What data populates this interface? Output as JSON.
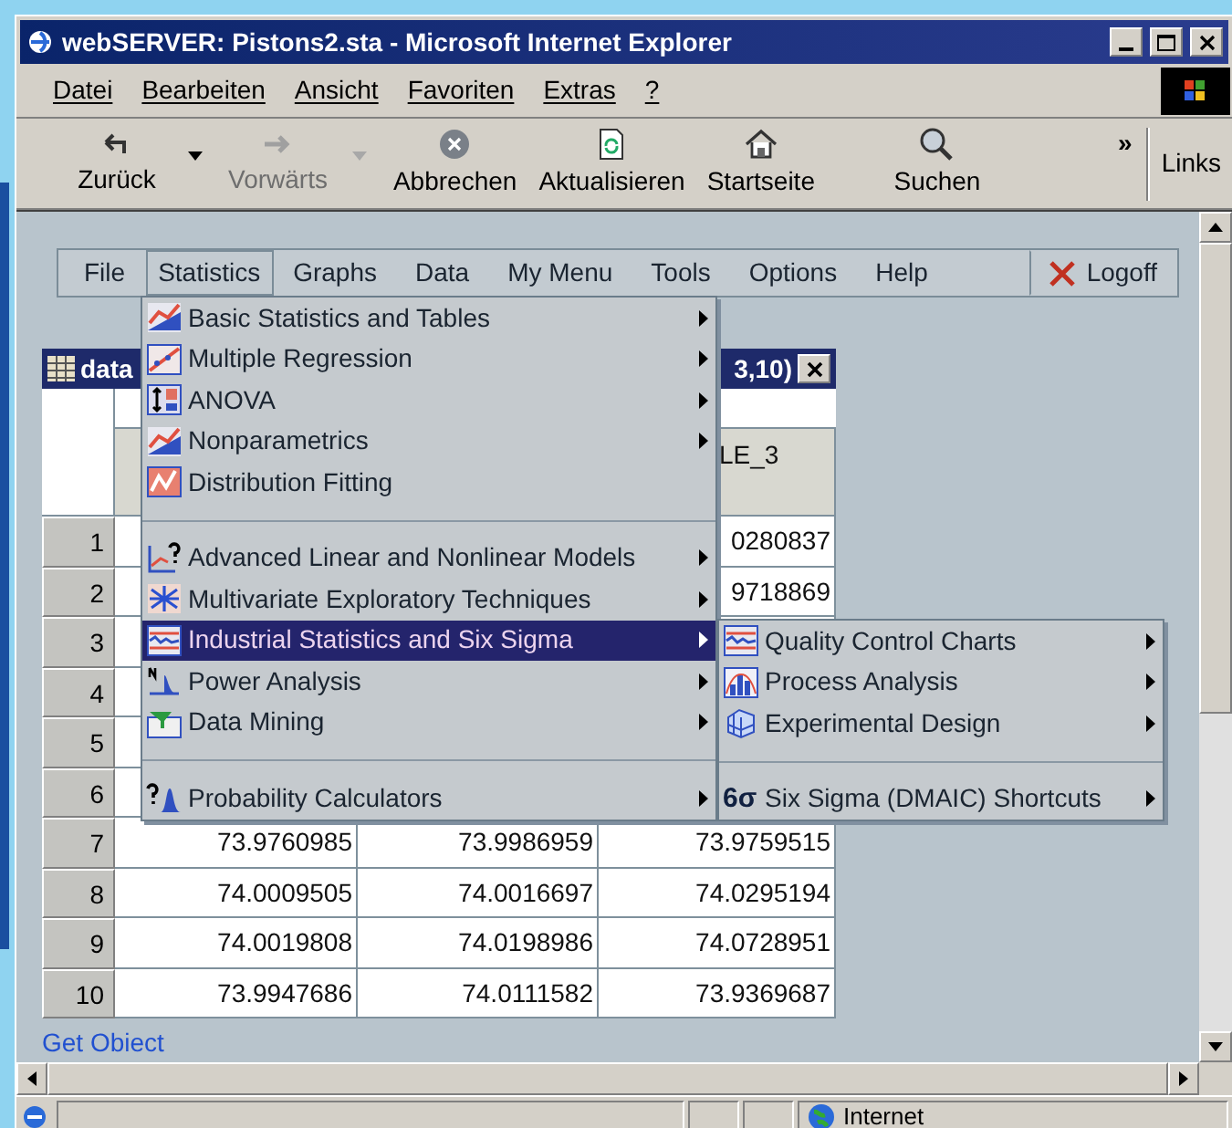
{
  "window": {
    "title": "webSERVER: Pistons2.sta - Microsoft Internet Explorer"
  },
  "menu_bar": [
    "Datei",
    "Bearbeiten",
    "Ansicht",
    "Favoriten",
    "Extras",
    "?"
  ],
  "toolbar": {
    "buttons": [
      {
        "label": "Zurück",
        "kind": "back",
        "disabled": false,
        "dropdown": true
      },
      {
        "label": "Vorwärts",
        "kind": "forward",
        "disabled": true,
        "dropdown": true
      },
      {
        "label": "Abbrechen",
        "kind": "stop",
        "disabled": false,
        "dropdown": false
      },
      {
        "label": "Aktualisieren",
        "kind": "refresh",
        "disabled": false,
        "dropdown": false
      },
      {
        "label": "Startseite",
        "kind": "home",
        "disabled": false,
        "dropdown": false
      },
      {
        "label": "Suchen",
        "kind": "search",
        "disabled": false,
        "dropdown": false
      }
    ],
    "overflow": "»",
    "links": "Links"
  },
  "app_menu": [
    {
      "label": "File",
      "selected": false,
      "kind": "plain"
    },
    {
      "label": "Statistics",
      "selected": true,
      "kind": "plain"
    },
    {
      "label": "Graphs",
      "selected": false,
      "kind": "plain"
    },
    {
      "label": "Data",
      "selected": false,
      "kind": "plain"
    },
    {
      "label": "My Menu",
      "selected": false,
      "kind": "plain"
    },
    {
      "label": "Tools",
      "selected": false,
      "kind": "plain"
    },
    {
      "label": "Options",
      "selected": false,
      "kind": "plain"
    },
    {
      "label": "Help",
      "selected": false,
      "kind": "plain"
    },
    {
      "label": "Logoff",
      "selected": false,
      "kind": "logoff"
    }
  ],
  "statistics_menu": [
    {
      "kind": "item",
      "label": "Basic Statistics and Tables",
      "submenu": true,
      "selected": false
    },
    {
      "kind": "item",
      "label": "Multiple Regression",
      "submenu": true,
      "selected": false
    },
    {
      "kind": "item",
      "label": "ANOVA",
      "submenu": true,
      "selected": false
    },
    {
      "kind": "item",
      "label": "Nonparametrics",
      "submenu": true,
      "selected": false
    },
    {
      "kind": "item",
      "label": "Distribution Fitting",
      "submenu": false,
      "selected": false
    },
    {
      "kind": "separator"
    },
    {
      "kind": "item",
      "label": "Advanced Linear and Nonlinear Models",
      "submenu": true,
      "selected": false
    },
    {
      "kind": "item",
      "label": "Multivariate Exploratory Techniques",
      "submenu": true,
      "selected": false
    },
    {
      "kind": "item",
      "label": "Industrial Statistics and Six Sigma",
      "submenu": true,
      "selected": true
    },
    {
      "kind": "item",
      "label": "Power Analysis",
      "submenu": true,
      "selected": false
    },
    {
      "kind": "item",
      "label": "Data Mining",
      "submenu": true,
      "selected": false
    },
    {
      "kind": "separator"
    },
    {
      "kind": "item",
      "label": "Probability Calculators",
      "submenu": true,
      "selected": false
    }
  ],
  "industrial_submenu": [
    {
      "kind": "item",
      "label": "Quality Control Charts",
      "submenu": true,
      "selected": false
    },
    {
      "kind": "item",
      "label": "Process Analysis",
      "submenu": true,
      "selected": false
    },
    {
      "kind": "item",
      "label": "Experimental Design",
      "submenu": true,
      "selected": false
    },
    {
      "kind": "separator"
    },
    {
      "kind": "item",
      "label": "Six Sigma (DMAIC) Shortcuts",
      "icon_text": "6σ",
      "submenu": true,
      "selected": false
    }
  ],
  "data_window": {
    "title_start": "data",
    "title_end": "3,10)",
    "column_3_header": "LE_3",
    "rows": [
      {
        "number": "1",
        "column_3": "0280837"
      },
      {
        "number": "2",
        "column_3": "9718869"
      },
      {
        "number": "3"
      },
      {
        "number": "4"
      },
      {
        "number": "5"
      },
      {
        "number": "6"
      },
      {
        "number": "7",
        "column_1": "73.9760985",
        "column_2": "73.9986959",
        "column_3": "73.9759515"
      },
      {
        "number": "8",
        "column_1": "74.0009505",
        "column_2": "74.0016697",
        "column_3": "74.0295194"
      },
      {
        "number": "9",
        "column_1": "74.0019808",
        "column_2": "74.0198986",
        "column_3": "74.0728951"
      },
      {
        "number": "10",
        "column_1": "73.9947686",
        "column_2": "74.0111582",
        "column_3": "73.9369687"
      }
    ]
  },
  "link": "Get Obiect",
  "status_bar": {
    "zone": "Internet"
  }
}
